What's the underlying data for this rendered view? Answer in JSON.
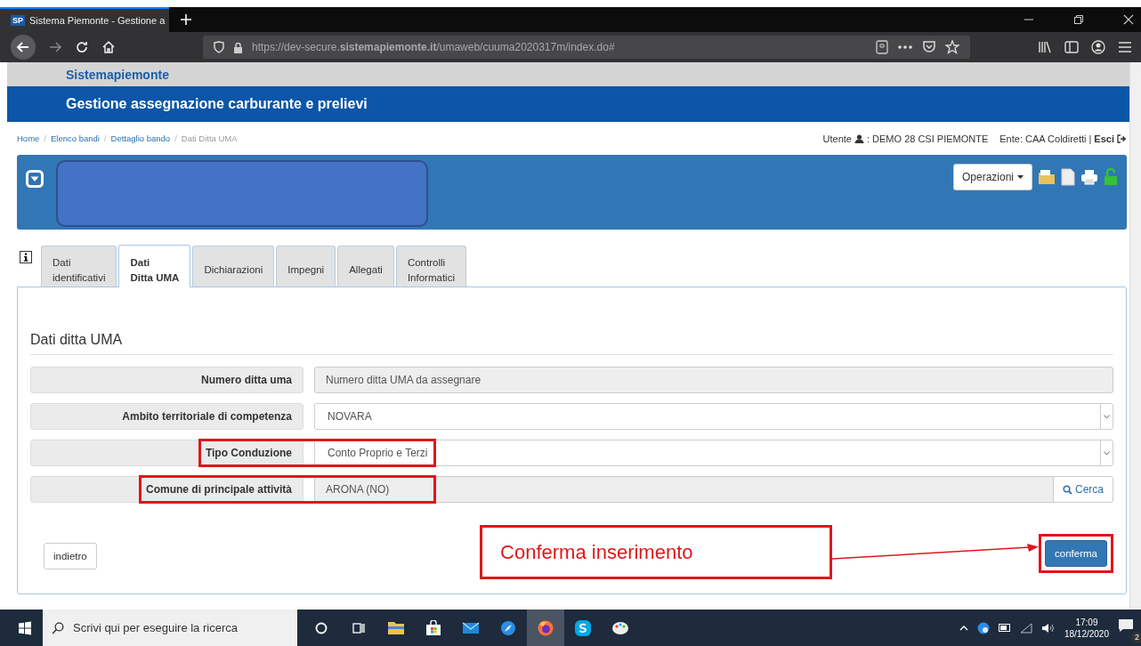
{
  "browser": {
    "tab_title": "Sistema Piemonte - Gestione a",
    "tab_favicon": "SP",
    "url": "https://dev-secure.**sistemapiemonte.it**/umaweb/cuuma2020317m/index.do#"
  },
  "site": {
    "brand": "Sistemapiemonte",
    "title": "Gestione assegnazione carburante e prelievi"
  },
  "breadcrumb_separator": "/",
  "breadcrumb": [
    {
      "label": "Home",
      "current": false
    },
    {
      "label": "Elenco bandi",
      "current": false
    },
    {
      "label": "Dettaglio bando",
      "current": false
    },
    {
      "label": "Dati Ditta UMA",
      "current": true
    }
  ],
  "user_bar": {
    "user_label": "Utente",
    "user": ": DEMO 28 CSI PIEMONTE",
    "ente": "Ente: CAA Coldiretti",
    "separator": "|",
    "logout": "Esci"
  },
  "panel": {
    "operations_button": "Operazioni"
  },
  "tabs": [
    {
      "lines": [
        "Dati",
        "identificativi"
      ],
      "selected": false
    },
    {
      "lines": [
        "Dati",
        "Ditta UMA"
      ],
      "selected": true
    },
    {
      "lines": [
        "Dichiarazioni"
      ],
      "selected": false
    },
    {
      "lines": [
        "Impegni"
      ],
      "selected": false
    },
    {
      "lines": [
        "Allegati"
      ],
      "selected": false
    },
    {
      "lines": [
        "Controlli",
        "Informatici"
      ],
      "selected": false
    }
  ],
  "section_title": "Dati ditta UMA",
  "fields": [
    {
      "kind": "text",
      "label": "Numero ditta uma",
      "value": "Numero ditta UMA da assegnare",
      "highlighted": false
    },
    {
      "kind": "select",
      "label": "Ambito territoriale di competenza",
      "value": "NOVARA",
      "highlighted": false
    },
    {
      "kind": "select",
      "label": "Tipo Conduzione",
      "value": "Conto Proprio e Terzi",
      "highlighted": true
    },
    {
      "kind": "lookup",
      "label": "Comune di principale attività",
      "value": "ARONA (NO)",
      "button": "Cerca",
      "highlighted": true
    }
  ],
  "back_button": "indietro",
  "annotation": "Conferma inserimento",
  "confirm_button": {
    "label": "conferma",
    "highlighted": true
  },
  "taskbar": {
    "search_placeholder": "Scrivi qui per eseguire la ricerca",
    "time": "17:09",
    "date": "18/12/2020",
    "notifications": "2",
    "apps": [
      {
        "kind": "cortana",
        "selected": false
      },
      {
        "kind": "taskview",
        "selected": false
      },
      {
        "kind": "folder",
        "selected": false
      },
      {
        "kind": "store",
        "selected": false
      },
      {
        "kind": "mail",
        "selected": false
      },
      {
        "kind": "compass",
        "selected": false
      },
      {
        "kind": "firefox",
        "selected": true
      },
      {
        "kind": "skype",
        "selected": false
      },
      {
        "kind": "paint",
        "selected": false
      }
    ]
  }
}
